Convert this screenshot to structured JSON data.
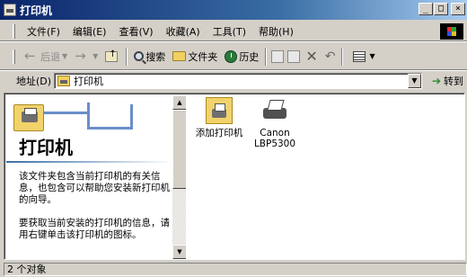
{
  "window": {
    "title": "打印机",
    "buttons": {
      "minimize": "_",
      "maximize": "□",
      "close": "×"
    }
  },
  "menu": {
    "items": [
      "文件(F)",
      "编辑(E)",
      "查看(V)",
      "收藏(A)",
      "工具(T)",
      "帮助(H)"
    ]
  },
  "toolbar": {
    "back": "后退",
    "search": "搜索",
    "folders": "文件夹",
    "history": "历史"
  },
  "address": {
    "label": "地址(D)",
    "value": "打印机",
    "go": "转到"
  },
  "left_pane": {
    "title": "打印机",
    "paragraph1": "该文件夹包含当前打印机的有关信息，也包含可以帮助您安装新打印机的向导。",
    "paragraph2": "要获取当前安装的打印机的信息，请用右键单击该打印机的图标。"
  },
  "items": [
    {
      "label": "添加打印机",
      "icon": "add-printer-icon"
    },
    {
      "label": "Canon\nLBP5300",
      "icon": "printer-icon"
    }
  ],
  "status": {
    "text": "2 个对象"
  }
}
